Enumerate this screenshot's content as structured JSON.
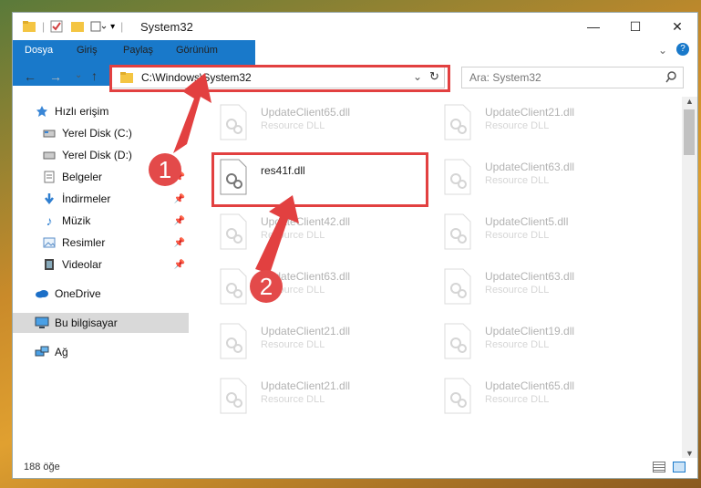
{
  "window": {
    "title": "System32",
    "controls": {
      "minimize": "—",
      "maximize": "☐",
      "close": "✕"
    }
  },
  "ribbon": {
    "tabs": [
      "Dosya",
      "Giriş",
      "Paylaş",
      "Görünüm"
    ]
  },
  "address_bar": {
    "path": "C:\\Windows\\System32"
  },
  "search": {
    "placeholder": "Ara: System32"
  },
  "sidebar": {
    "items": [
      {
        "label": "Hızlı erişim",
        "icon": "star-icon"
      },
      {
        "label": "Yerel Disk (C:)",
        "icon": "drive-icon"
      },
      {
        "label": "Yerel Disk (D:)",
        "icon": "drive-icon"
      },
      {
        "label": "Belgeler",
        "icon": "documents-icon"
      },
      {
        "label": "İndirmeler",
        "icon": "download-icon"
      },
      {
        "label": "Müzik",
        "icon": "music-icon"
      },
      {
        "label": "Resimler",
        "icon": "pictures-icon"
      },
      {
        "label": "Videolar",
        "icon": "video-icon"
      },
      {
        "label": "OneDrive",
        "icon": "cloud-icon"
      },
      {
        "label": "Bu bilgisayar",
        "icon": "computer-icon"
      },
      {
        "label": "Ağ",
        "icon": "network-icon"
      }
    ]
  },
  "files": {
    "col1": [
      {
        "name": "UpdateClient65.dll",
        "type": "Resource DLL"
      },
      {
        "name": "res41f.dll",
        "type": ""
      },
      {
        "name": "UpdateClient42.dll",
        "type": "Resource DLL"
      },
      {
        "name": "UpdateClient63.dll",
        "type": "Resource DLL"
      },
      {
        "name": "UpdateClient21.dll",
        "type": "Resource DLL"
      },
      {
        "name": "UpdateClient21.dll",
        "type": "Resource DLL"
      }
    ],
    "col2": [
      {
        "name": "UpdateClient21.dll",
        "type": "Resource DLL"
      },
      {
        "name": "UpdateClient63.dll",
        "type": "Resource DLL"
      },
      {
        "name": "UpdateClient5.dll",
        "type": "Resource DLL"
      },
      {
        "name": "UpdateClient63.dll",
        "type": "Resource DLL"
      },
      {
        "name": "UpdateClient19.dll",
        "type": "Resource DLL"
      },
      {
        "name": "UpdateClient65.dll",
        "type": "Resource DLL"
      }
    ]
  },
  "status": {
    "count": "188 öğe"
  },
  "annotations": {
    "step1": "1",
    "step2": "2"
  },
  "colors": {
    "accent": "#1979ca",
    "annotation": "#e24040"
  }
}
